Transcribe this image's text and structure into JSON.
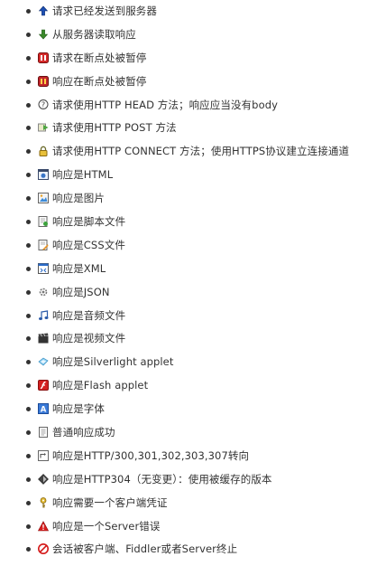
{
  "items": [
    {
      "label": "请求已经发送到服务器",
      "icon": "up-arrow-icon"
    },
    {
      "label": "从服务器读取响应",
      "icon": "down-arrow-icon"
    },
    {
      "label": "请求在断点处被暂停",
      "icon": "breakpoint-request-icon"
    },
    {
      "label": "响应在断点处被暂停",
      "icon": "breakpoint-response-icon"
    },
    {
      "label": "请求使用HTTP HEAD 方法；响应应当没有body",
      "icon": "head-method-icon"
    },
    {
      "label": "请求使用HTTP POST 方法",
      "icon": "post-method-icon"
    },
    {
      "label": "请求使用HTTP CONNECT 方法；使用HTTPS协议建立连接通道",
      "icon": "lock-icon"
    },
    {
      "label": "响应是HTML",
      "icon": "html-icon"
    },
    {
      "label": "响应是图片",
      "icon": "image-icon"
    },
    {
      "label": "响应是脚本文件",
      "icon": "script-icon"
    },
    {
      "label": "响应是CSS文件",
      "icon": "css-icon"
    },
    {
      "label": "响应是XML",
      "icon": "xml-icon"
    },
    {
      "label": "响应是JSON",
      "icon": "json-icon"
    },
    {
      "label": "响应是音频文件",
      "icon": "audio-icon"
    },
    {
      "label": "响应是视频文件",
      "icon": "video-icon"
    },
    {
      "label": "响应是Silverlight applet",
      "icon": "silverlight-icon"
    },
    {
      "label": "响应是Flash applet",
      "icon": "flash-icon"
    },
    {
      "label": "响应是字体",
      "icon": "font-icon"
    },
    {
      "label": "普通响应成功",
      "icon": "document-icon"
    },
    {
      "label": "响应是HTTP/300,301,302,303,307转向",
      "icon": "redirect-icon"
    },
    {
      "label": "响应是HTTP304（无变更）：使用被缓存的版本",
      "icon": "cache-icon"
    },
    {
      "label": "响应需要一个客户端凭证",
      "icon": "key-icon"
    },
    {
      "label": "响应是一个Server错误",
      "icon": "warning-icon"
    },
    {
      "label": "会话被客户端、Fiddler或者Server终止",
      "icon": "stop-icon"
    }
  ]
}
